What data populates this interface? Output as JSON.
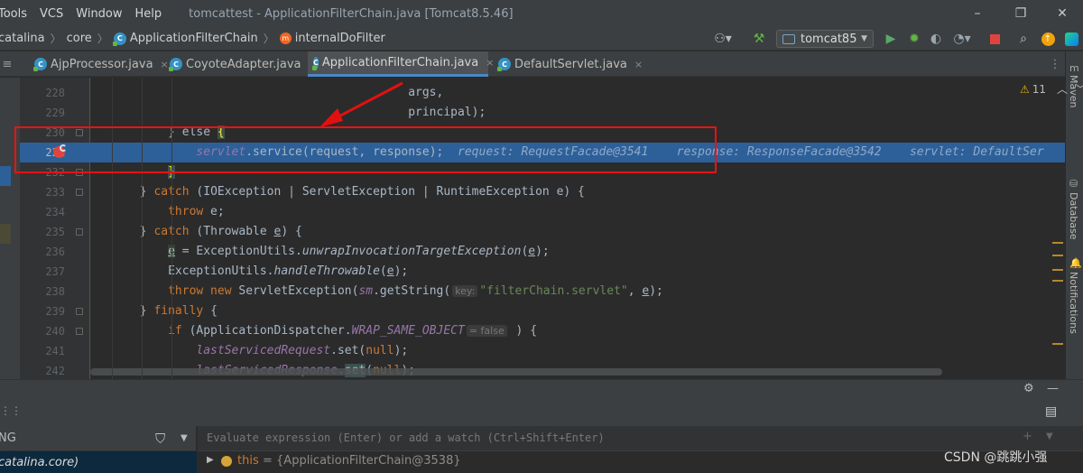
{
  "menu": [
    "Tools",
    "VCS",
    "Window",
    "Help"
  ],
  "window_title": "tomcattest - ApplicationFilterChain.java [Tomcat8.5.46]",
  "window_controls": {
    "minimize": "–",
    "restore": "❐",
    "close": "✕"
  },
  "breadcrumb": [
    "catalina",
    "core",
    "ApplicationFilterChain",
    "internalDoFilter"
  ],
  "toolbar": {
    "run_config": "tomcat85"
  },
  "tabs": [
    {
      "label": "AjpProcessor.java",
      "close": "×"
    },
    {
      "label": "CoyoteAdapter.java",
      "close": "×"
    },
    {
      "label": "ApplicationFilterChain.java",
      "close": "×"
    },
    {
      "label": "DefaultServlet.java",
      "close": "×"
    }
  ],
  "right_tools": [
    "Maven",
    "Database",
    "Notifications"
  ],
  "inspections": {
    "warnings": "11"
  },
  "line_numbers": [
    "228",
    "229",
    "230",
    "231",
    "232",
    "233",
    "234",
    "235",
    "236",
    "237",
    "238",
    "239",
    "240",
    "241",
    "242"
  ],
  "code": {
    "l228": "args,",
    "l229": "principal);",
    "l230a": "} else ",
    "l230b": "{",
    "l231_servlet": "servlet",
    "l231_rest": ".service(request, response);",
    "l231_dbg1": "request: RequestFacade@3541",
    "l231_dbg2": "response: ResponseFacade@3542",
    "l231_dbg3": "servlet: DefaultSer",
    "l232": "}",
    "l233a": "} ",
    "l233kw": "catch",
    "l233b": " (IOException | ServletException | RuntimeException e) {",
    "l234kw": "throw",
    "l234b": " e;",
    "l235a": "} ",
    "l235kw": "catch",
    "l235b": " (Throwable ",
    "l235c": "e",
    "l235d": ") {",
    "l236a": "e",
    "l236b": " = ExceptionUtils.",
    "l236c": "unwrapInvocationTargetException",
    "l236d": "(",
    "l236e": "e",
    "l236f": ");",
    "l237a": "ExceptionUtils.",
    "l237b": "handleThrowable",
    "l237c": "(",
    "l237d": "e",
    "l237e": ");",
    "l238kw1": "throw",
    "l238kw2": " new",
    "l238b": " ServletException(",
    "l238sm": "sm",
    "l238c": ".getString(",
    "l238hint": "key:",
    "l238str": "\"filterChain.servlet\"",
    "l238d": ", ",
    "l238e": "e",
    "l238f": ");",
    "l239a": "} ",
    "l239kw": "finally",
    "l239b": " {",
    "l240kw": "if",
    "l240b": " (ApplicationDispatcher.",
    "l240c": "WRAP_SAME_OBJECT",
    "l240hint": "= false",
    "l240d": " ) {",
    "l241a": "lastServicedRequest",
    "l241b": ".set(",
    "l241kw": "null",
    "l241c": ");",
    "l242a": "lastServicedResponse",
    "l242b": ".",
    "l242c": "set",
    "l242d": "(",
    "l242kw": "null",
    "l242e": ");"
  },
  "debugger": {
    "frames_label": "NG",
    "current_frame": "catalina.core)",
    "eval_placeholder": "Evaluate expression (Enter) or add a watch (Ctrl+Shift+Enter)",
    "var_name": "this",
    "var_value": "= {ApplicationFilterChain@3538}"
  },
  "watermark": "CSDN @跳跳小强",
  "colors": {
    "accent": "#4a88c7",
    "exec_line": "#2d6099",
    "annotation": "#e11111",
    "breakpoint": "#e0443e"
  }
}
